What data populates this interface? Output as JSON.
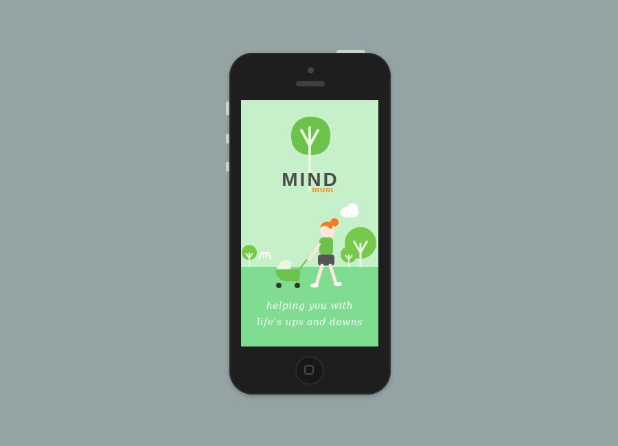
{
  "app": {
    "brand_name": "MIND",
    "brand_subtitle": "mum",
    "tagline_line1": "helping you with",
    "tagline_line2": "life's ups and downs"
  },
  "device": {
    "type": "smartphone",
    "frame_color": "#1e1e1e",
    "background_color": "#94a3a3"
  },
  "colors": {
    "screen_bg": "#c6f0c9",
    "grass": "#7fdc91",
    "tree": "#6cc24a",
    "accent_orange": "#f2941f",
    "brand_text": "#4d4d4d"
  },
  "icons": {
    "logo": "tree-icon",
    "home_button": "home-square-icon"
  }
}
